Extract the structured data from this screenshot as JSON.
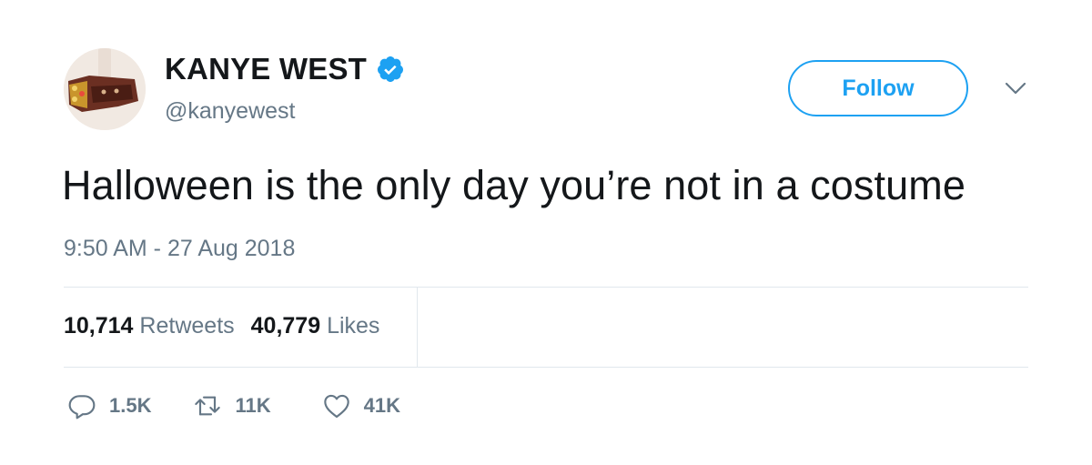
{
  "author": {
    "display_name": "KANYE WEST",
    "handle": "@kanyewest",
    "verified": true
  },
  "follow_button": {
    "label": "Follow"
  },
  "tweet": {
    "text": "Halloween is the only day you’re not in a costume",
    "timestamp": "9:50 AM - 27 Aug 2018"
  },
  "stats": {
    "retweets_count": "10,714",
    "retweets_label": "Retweets",
    "likes_count": "40,779",
    "likes_label": "Likes"
  },
  "actions": {
    "reply_count": "1.5K",
    "retweet_count": "11K",
    "like_count": "41K"
  },
  "icons": {
    "verified": "verified-badge-icon",
    "caret": "chevron-down-icon",
    "reply": "reply-icon",
    "retweet": "retweet-icon",
    "like": "heart-icon"
  },
  "colors": {
    "accent": "#1da1f2",
    "text_primary": "#14171a",
    "text_secondary": "#657786",
    "divider": "#e1e8ed"
  }
}
